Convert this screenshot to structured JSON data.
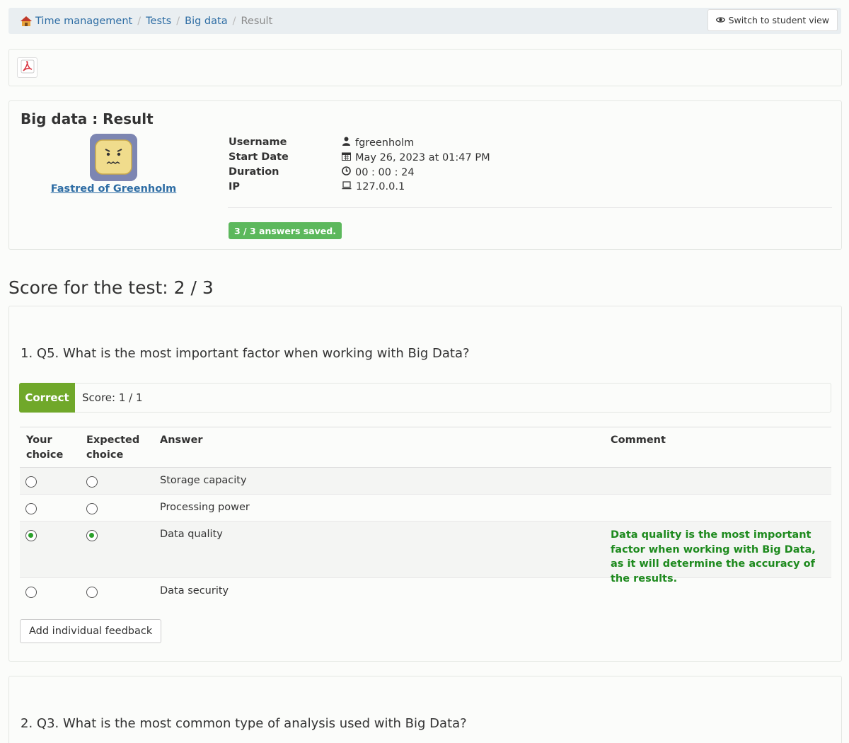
{
  "breadcrumb": {
    "items": [
      "Time management",
      "Tests",
      "Big data"
    ],
    "current": "Result"
  },
  "toolbar": {
    "switch_label": "Switch to student view"
  },
  "result": {
    "title": "Big data : Result",
    "user_display": "Fastred of Greenholm",
    "labels": {
      "username": "Username",
      "start_date": "Start Date",
      "duration": "Duration",
      "ip": "IP"
    },
    "values": {
      "username": "fgreenholm",
      "start_date": "May 26, 2023 at 01:47 PM",
      "duration": "00 : 00 : 24",
      "ip": "127.0.0.1"
    },
    "saved_badge": "3 / 3 answers saved."
  },
  "score_title": "Score for the test: 2 / 3",
  "question1": {
    "title": "1. Q5. What is the most important factor when working with Big Data?",
    "status": "Correct",
    "score": "Score: 1 / 1",
    "headers": {
      "your_choice": [
        "Your",
        "choice"
      ],
      "expected_choice": [
        "Expected",
        "choice"
      ],
      "answer": "Answer",
      "comment": "Comment"
    },
    "answers": [
      {
        "label": "Storage capacity",
        "your": false,
        "expected": false,
        "comment": ""
      },
      {
        "label": "Processing power",
        "your": false,
        "expected": false,
        "comment": ""
      },
      {
        "label": "Data quality",
        "your": true,
        "expected": true,
        "comment": "Data quality is the most important factor when working with Big Data, as it will determine the accuracy of the results."
      },
      {
        "label": "Data security",
        "your": false,
        "expected": false,
        "comment": ""
      }
    ],
    "feedback_button": "Add individual feedback"
  },
  "question2": {
    "title": "2. Q3. What is the most common type of analysis used with Big Data?"
  },
  "colors": {
    "link": "#2e6da4",
    "correct": "#70a82a",
    "saved": "#5cb85c",
    "comment": "#1e8a1e"
  },
  "icons": [
    "home-icon",
    "eye-icon",
    "pdf-icon",
    "user-icon",
    "calendar-icon",
    "clock-icon",
    "laptop-icon"
  ]
}
